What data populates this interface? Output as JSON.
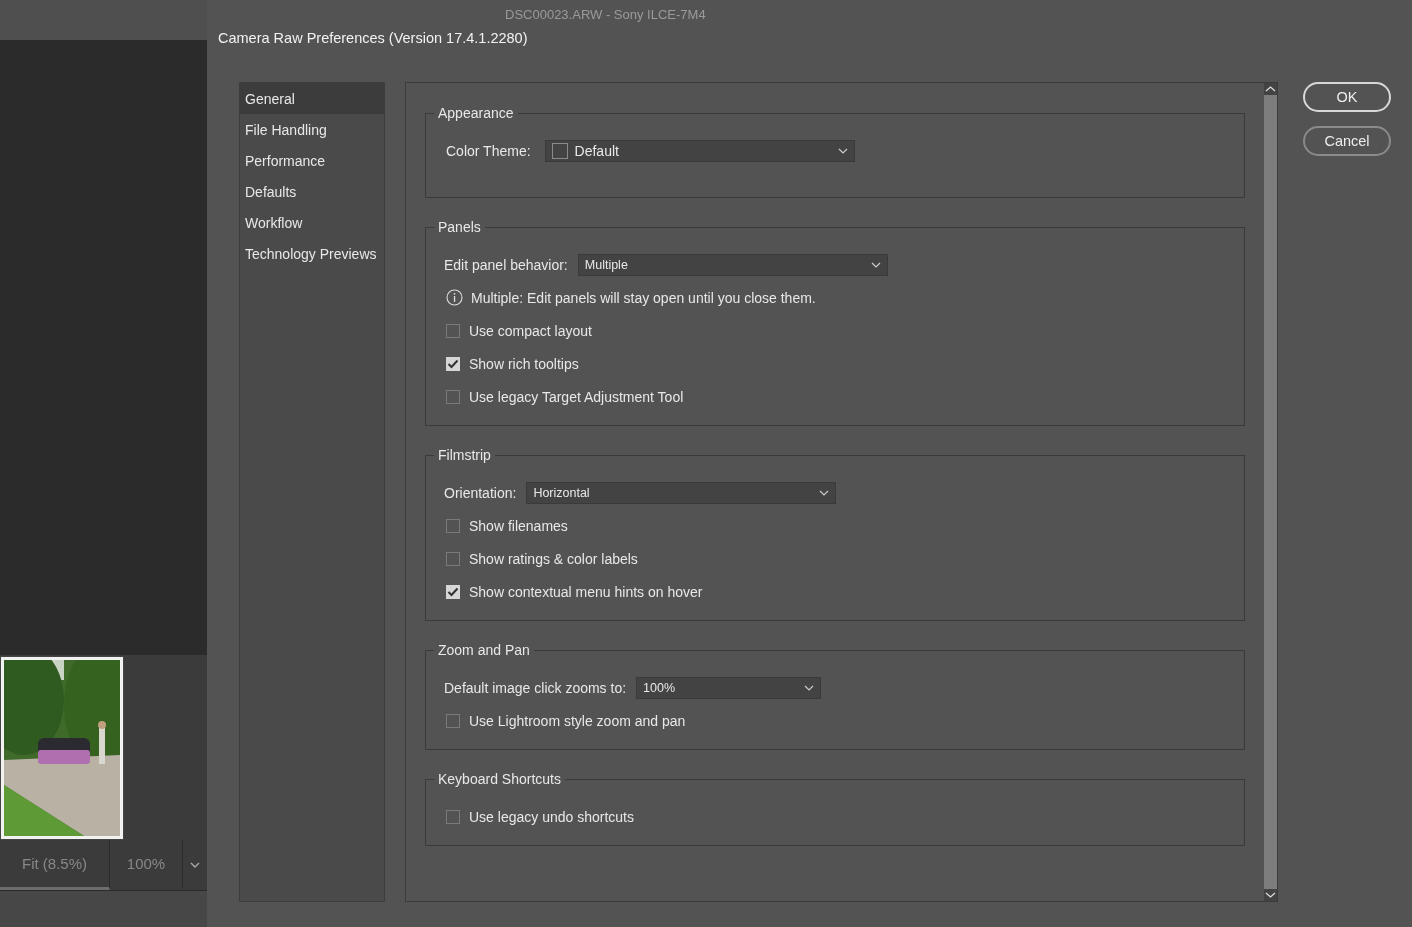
{
  "background_title": "DSC00023.ARW  -  Sony ILCE-7M4",
  "filmstrip": {
    "zoom_buttons": [
      {
        "label": "Fit (8.5%)",
        "selected": true
      },
      {
        "label": "100%",
        "selected": false
      }
    ]
  },
  "dialog": {
    "title": "Camera Raw Preferences  (Version 17.4.1.2280)",
    "categories": [
      {
        "label": "General",
        "selected": true
      },
      {
        "label": "File Handling",
        "selected": false
      },
      {
        "label": "Performance",
        "selected": false
      },
      {
        "label": "Defaults",
        "selected": false
      },
      {
        "label": "Workflow",
        "selected": false
      },
      {
        "label": "Technology Previews",
        "selected": false
      }
    ],
    "sections": [
      {
        "title": "Appearance",
        "items": [
          {
            "kind": "dropdown",
            "label": "Color Theme:",
            "value": "Default",
            "swatch": true
          }
        ]
      },
      {
        "title": "Panels",
        "items": [
          {
            "kind": "dropdown",
            "label": "Edit panel behavior:",
            "value": "Multiple",
            "swatch": false
          },
          {
            "kind": "info",
            "text": "Multiple: Edit panels will stay open until you close them."
          },
          {
            "kind": "checkbox",
            "label": "Use compact layout",
            "checked": false
          },
          {
            "kind": "checkbox",
            "label": "Show rich tooltips",
            "checked": true
          },
          {
            "kind": "checkbox",
            "label": "Use legacy Target Adjustment Tool",
            "checked": false
          }
        ]
      },
      {
        "title": "Filmstrip",
        "items": [
          {
            "kind": "dropdown",
            "label": "Orientation:",
            "value": "Horizontal",
            "swatch": false
          },
          {
            "kind": "checkbox",
            "label": "Show filenames",
            "checked": false
          },
          {
            "kind": "checkbox",
            "label": "Show ratings & color labels",
            "checked": false
          },
          {
            "kind": "checkbox",
            "label": "Show contextual menu hints on hover",
            "checked": true
          }
        ]
      },
      {
        "title": "Zoom and Pan",
        "items": [
          {
            "kind": "dropdown",
            "label": "Default image click zooms to:",
            "value": "100%",
            "swatch": false
          },
          {
            "kind": "checkbox",
            "label": "Use Lightroom style zoom and pan",
            "checked": false
          }
        ]
      },
      {
        "title": "Keyboard Shortcuts",
        "items": [
          {
            "kind": "checkbox",
            "label": "Use legacy undo shortcuts",
            "checked": false
          }
        ]
      }
    ],
    "buttons": [
      {
        "label": "OK",
        "default": true
      },
      {
        "label": "Cancel",
        "default": false
      }
    ]
  }
}
